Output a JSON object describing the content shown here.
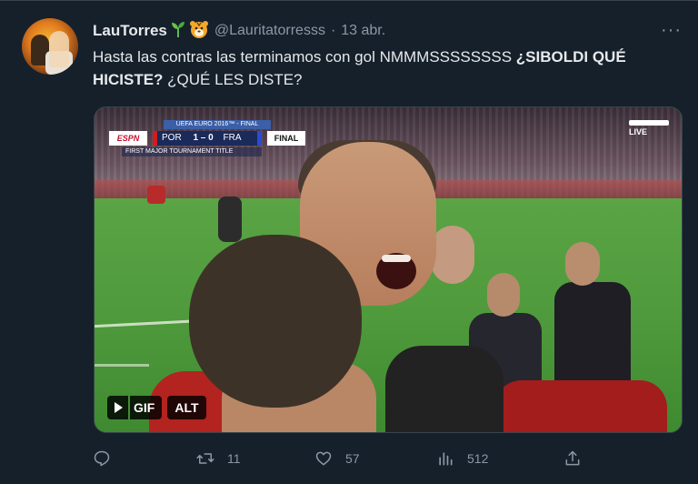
{
  "tweet": {
    "display_name": "LauTorres",
    "name_emojis": [
      "seedling-emoji",
      "tiger-face-emoji"
    ],
    "handle": "@Lauritatorresss",
    "separator": "·",
    "date": "13 abr.",
    "more_label": "···",
    "text_plain": "Hasta las contras las terminamos con gol NMMMSSSSSSSS ",
    "text_bold": "¿SIBOLDI QUÉ HICISTE?",
    "text_tail": " ¿QUÉ LES DISTE?"
  },
  "media": {
    "type": "gif",
    "scorebug": {
      "header": "UEFA EURO 2016™ - FINAL",
      "broadcaster": "ESPN",
      "team_home": "POR",
      "score": "1 – 0",
      "team_away": "FRA",
      "status": "FINAL",
      "subtitle": "FIRST MAJOR TOURNAMENT TITLE"
    },
    "live_label": "LIVE",
    "badges": {
      "gif": "GIF",
      "alt": "ALT"
    }
  },
  "actions": {
    "reply_count": "",
    "retweet_count": "11",
    "like_count": "57",
    "views_count": "512",
    "icons": [
      "reply-icon",
      "retweet-icon",
      "like-icon",
      "views-icon",
      "share-icon"
    ]
  },
  "colors": {
    "background": "#15202b",
    "text": "#e7e9ea",
    "secondary": "#8b98a5",
    "divider": "#38444d"
  }
}
